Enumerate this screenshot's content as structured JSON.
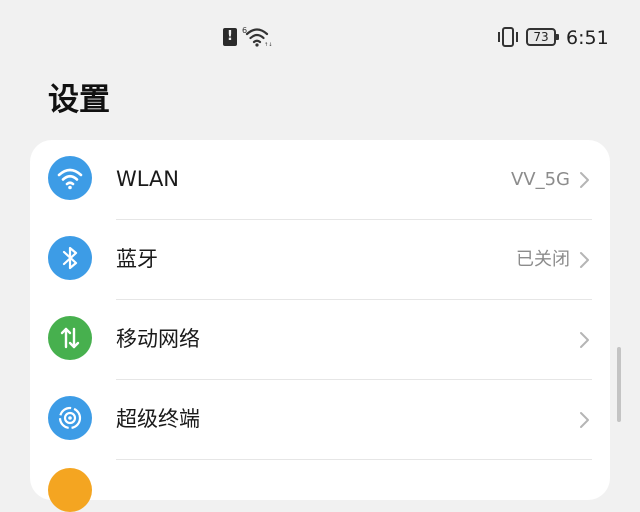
{
  "status_bar": {
    "alert_icon": "alert-icon",
    "wifi_icon": "wifi-6-icon",
    "vibrate_icon": "vibrate-icon",
    "battery_level": "73",
    "time": "6:51"
  },
  "page": {
    "title": "设置"
  },
  "settings": [
    {
      "label": "WLAN",
      "value": "VV_5G",
      "icon": "wifi-icon",
      "icon_color": "#3d9ce6"
    },
    {
      "label": "蓝牙",
      "value": "已关闭",
      "icon": "bluetooth-icon",
      "icon_color": "#3d9ce6"
    },
    {
      "label": "移动网络",
      "value": "",
      "icon": "mobile-data-icon",
      "icon_color": "#47b04e"
    },
    {
      "label": "超级终端",
      "value": "",
      "icon": "super-device-icon",
      "icon_color": "#3d9ce6"
    }
  ],
  "next_item_icon_color": "#f4a521"
}
